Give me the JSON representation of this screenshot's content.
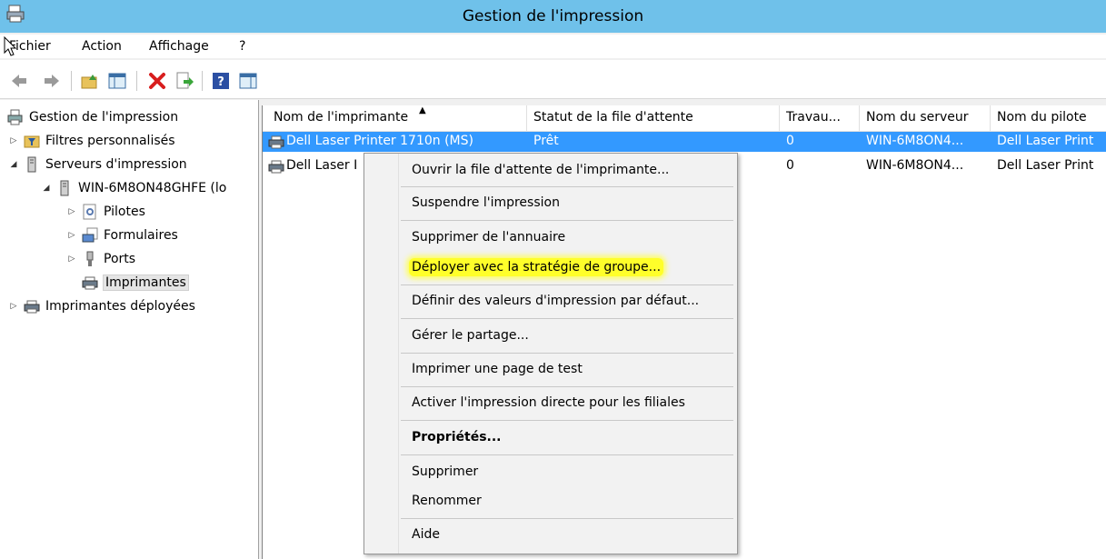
{
  "window": {
    "title": "Gestion de l'impression",
    "titlebar_color": "#6fc1ea"
  },
  "menu": {
    "items": [
      "Fichier",
      "Action",
      "Affichage",
      "?"
    ]
  },
  "toolbar": {
    "icons": [
      "back-icon",
      "forward-icon",
      "up-folder-icon",
      "show-hide-tree-icon",
      "delete-icon",
      "export-icon",
      "help-icon",
      "view-icon"
    ]
  },
  "tree": {
    "root": "Gestion de l'impression",
    "filters": "Filtres personnalisés",
    "servers": "Serveurs d'impression",
    "server": "WIN-6M8ON48GHFE (lo",
    "drivers": "Pilotes",
    "forms": "Formulaires",
    "ports": "Ports",
    "printers": "Imprimantes",
    "deployed": "Imprimantes déployées"
  },
  "list": {
    "columns": [
      "Nom de l'imprimante",
      "Statut de la file d'attente",
      "Travau...",
      "Nom du serveur",
      "Nom du pilote"
    ],
    "rows": [
      {
        "name": "Dell Laser Printer 1710n (MS)",
        "status": "Prêt",
        "jobs": "0",
        "server": "WIN-6M8ON4...",
        "driver": "Dell Laser Print"
      },
      {
        "name": "Dell Laser I",
        "status": "",
        "jobs": "0",
        "server": "WIN-6M8ON4...",
        "driver": "Dell Laser Print"
      }
    ],
    "selection_color": "#3399ff"
  },
  "context_menu": {
    "open_queue": "Ouvrir la file d'attente de l'imprimante...",
    "pause": "Suspendre l'impression",
    "remove_directory": "Supprimer de l'annuaire",
    "deploy_gpo": "Déployer avec la stratégie de groupe...",
    "set_defaults": "Définir des valeurs d'impression par défaut...",
    "manage_sharing": "Gérer le partage...",
    "print_test": "Imprimer une page de test",
    "direct_printing": "Activer l'impression directe pour les filiales",
    "properties": "Propriétés...",
    "delete": "Supprimer",
    "rename": "Renommer",
    "help": "Aide",
    "highlight_color": "#ffff2a"
  }
}
